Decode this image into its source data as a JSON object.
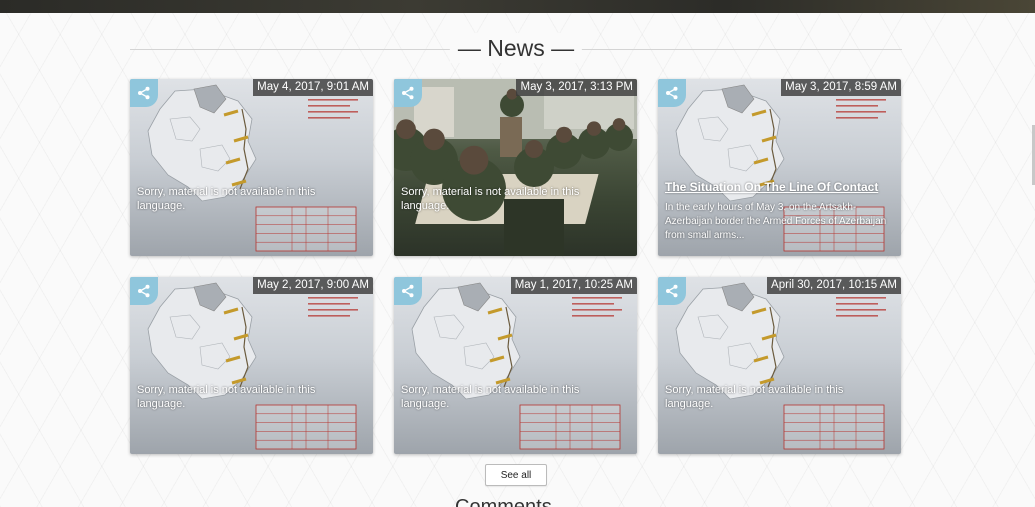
{
  "section": {
    "title": "— News —"
  },
  "cards": [
    {
      "date": "May 4, 2017, 9:01 AM",
      "type": "map",
      "text": "Sorry, material is not available in this language."
    },
    {
      "date": "May 3, 2017, 3:13 PM",
      "type": "photo",
      "text": "Sorry, material is not available in this language."
    },
    {
      "date": "May 3, 2017, 8:59 AM",
      "type": "map",
      "title": "The Situation On The Line Of Contact",
      "excerpt": "In the early hours of May 3, on the Artsakh-Azerbaijan border the Armed Forces of Azerbaijan from small arms..."
    },
    {
      "date": "May 2, 2017, 9:00 AM",
      "type": "map",
      "text": "Sorry, material is not available in this language."
    },
    {
      "date": "May 1, 2017, 10:25 AM",
      "type": "map",
      "text": "Sorry, material is not available in this language."
    },
    {
      "date": "April 30, 2017, 10:15 AM",
      "type": "map",
      "text": "Sorry, material is not available in this language."
    }
  ],
  "see_all_label": "See all",
  "next_section": {
    "title": "Comments"
  },
  "colors": {
    "share": "#8fc6dc",
    "badge": "#3c3c3c",
    "table_lines": "#b5342f"
  },
  "icons": {
    "share": "share-icon"
  }
}
